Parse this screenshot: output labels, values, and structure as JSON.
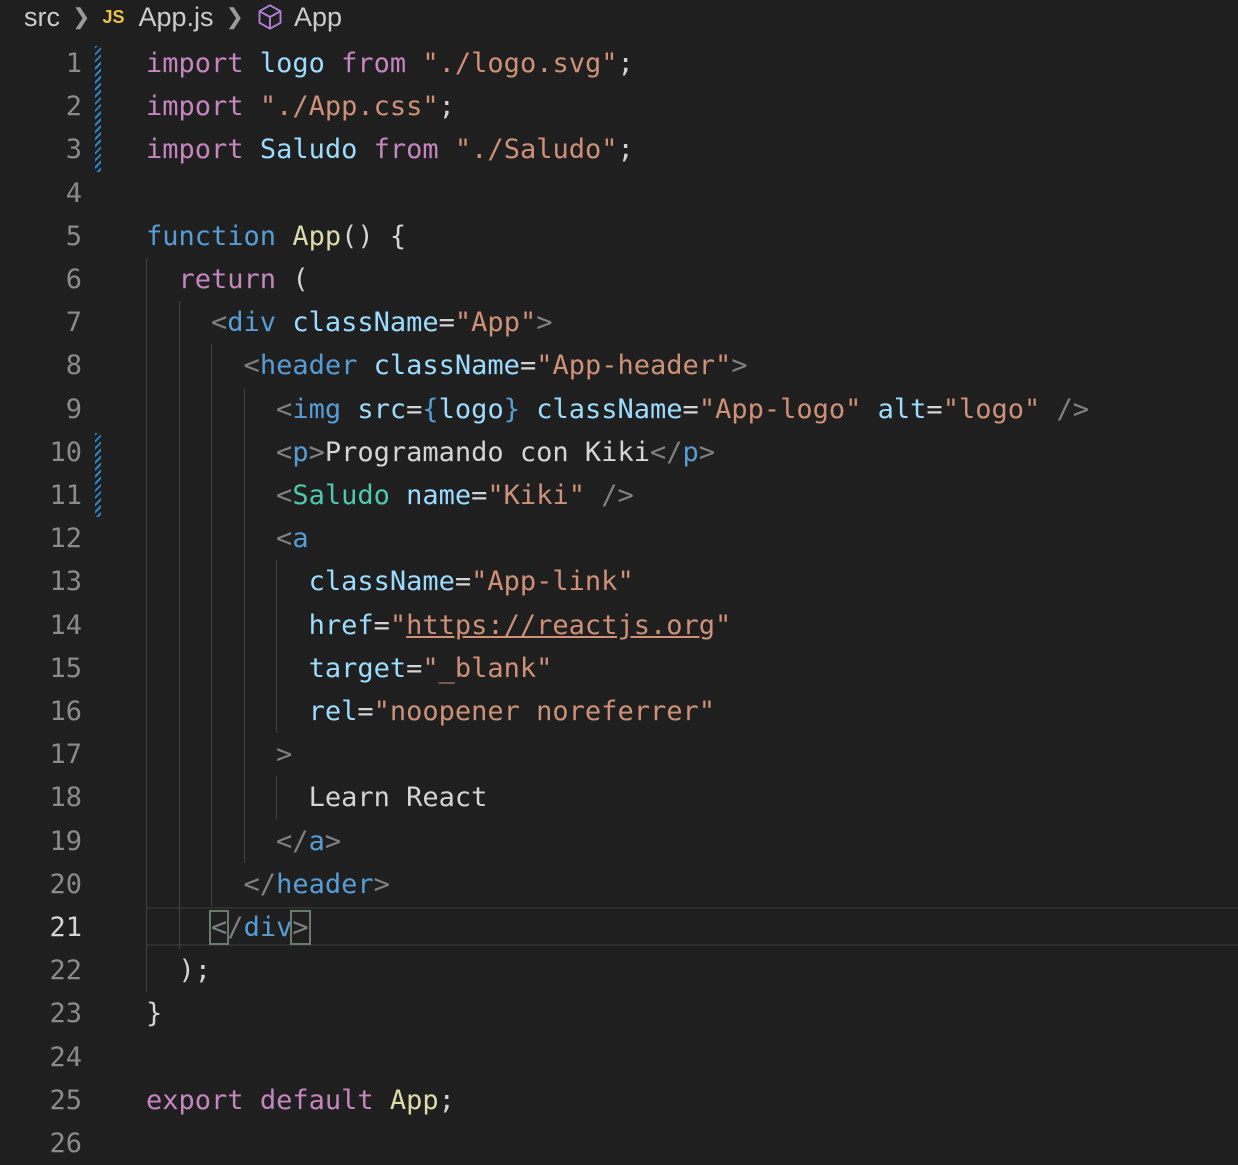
{
  "breadcrumb": {
    "folder": "src",
    "file_icon": "JS",
    "file": "App.js",
    "symbol": "App"
  },
  "editor": {
    "active_line": 21,
    "lines": [
      {
        "n": "1",
        "tokens": [
          [
            "import",
            "kw"
          ],
          [
            " ",
            ""
          ],
          [
            "logo",
            "var"
          ],
          [
            " ",
            ""
          ],
          [
            "from",
            "kw"
          ],
          [
            " ",
            ""
          ],
          [
            "\"./logo.svg\"",
            "str"
          ],
          [
            ";",
            ""
          ]
        ]
      },
      {
        "n": "2",
        "tokens": [
          [
            "import",
            "kw"
          ],
          [
            " ",
            ""
          ],
          [
            "\"./App.css\"",
            "str"
          ],
          [
            ";",
            ""
          ]
        ]
      },
      {
        "n": "3",
        "tokens": [
          [
            "import",
            "kw"
          ],
          [
            " ",
            ""
          ],
          [
            "Saludo",
            "var"
          ],
          [
            " ",
            ""
          ],
          [
            "from",
            "kw"
          ],
          [
            " ",
            ""
          ],
          [
            "\"./Saludo\"",
            "str"
          ],
          [
            ";",
            ""
          ]
        ]
      },
      {
        "n": "4",
        "tokens": []
      },
      {
        "n": "5",
        "tokens": [
          [
            "function",
            "kwb"
          ],
          [
            " ",
            ""
          ],
          [
            "App",
            "fn"
          ],
          [
            "() {",
            ""
          ]
        ]
      },
      {
        "n": "6",
        "tokens": [
          [
            "  ",
            ""
          ],
          [
            "return",
            "kw"
          ],
          [
            " (",
            ""
          ]
        ]
      },
      {
        "n": "7",
        "tokens": [
          [
            "    ",
            ""
          ],
          [
            "<",
            "punct"
          ],
          [
            "div",
            "tag"
          ],
          [
            " ",
            ""
          ],
          [
            "className",
            "var"
          ],
          [
            "=",
            ""
          ],
          [
            "\"App\"",
            "str"
          ],
          [
            ">",
            "punct"
          ]
        ]
      },
      {
        "n": "8",
        "tokens": [
          [
            "      ",
            ""
          ],
          [
            "<",
            "punct"
          ],
          [
            "header",
            "tag"
          ],
          [
            " ",
            ""
          ],
          [
            "className",
            "var"
          ],
          [
            "=",
            ""
          ],
          [
            "\"App-header\"",
            "str"
          ],
          [
            ">",
            "punct"
          ]
        ]
      },
      {
        "n": "9",
        "tokens": [
          [
            "        ",
            ""
          ],
          [
            "<",
            "punct"
          ],
          [
            "img",
            "tag"
          ],
          [
            " ",
            ""
          ],
          [
            "src",
            "var"
          ],
          [
            "=",
            ""
          ],
          [
            "{",
            "kwb"
          ],
          [
            "logo",
            "var"
          ],
          [
            "}",
            "kwb"
          ],
          [
            " ",
            ""
          ],
          [
            "className",
            "var"
          ],
          [
            "=",
            ""
          ],
          [
            "\"App-logo\"",
            "str"
          ],
          [
            " ",
            ""
          ],
          [
            "alt",
            "var"
          ],
          [
            "=",
            ""
          ],
          [
            "\"logo\"",
            "str"
          ],
          [
            " ",
            ""
          ],
          [
            "/>",
            "punct"
          ]
        ]
      },
      {
        "n": "10",
        "tokens": [
          [
            "        ",
            ""
          ],
          [
            "<",
            "punct"
          ],
          [
            "p",
            "tag"
          ],
          [
            ">",
            "punct"
          ],
          [
            "Programando con Kiki",
            ""
          ],
          [
            "</",
            "punct"
          ],
          [
            "p",
            "tag"
          ],
          [
            ">",
            "punct"
          ]
        ]
      },
      {
        "n": "11",
        "tokens": [
          [
            "        ",
            ""
          ],
          [
            "<",
            "punct"
          ],
          [
            "Saludo",
            "comp"
          ],
          [
            " ",
            ""
          ],
          [
            "name",
            "var"
          ],
          [
            "=",
            ""
          ],
          [
            "\"Kiki\"",
            "str"
          ],
          [
            " ",
            ""
          ],
          [
            "/>",
            "punct"
          ]
        ]
      },
      {
        "n": "12",
        "tokens": [
          [
            "        ",
            ""
          ],
          [
            "<",
            "punct"
          ],
          [
            "a",
            "tag"
          ]
        ]
      },
      {
        "n": "13",
        "tokens": [
          [
            "          ",
            ""
          ],
          [
            "className",
            "var"
          ],
          [
            "=",
            ""
          ],
          [
            "\"App-link\"",
            "str"
          ]
        ]
      },
      {
        "n": "14",
        "tokens": [
          [
            "          ",
            ""
          ],
          [
            "href",
            "var"
          ],
          [
            "=",
            ""
          ],
          [
            "\"",
            "str"
          ],
          [
            "https://reactjs.org",
            "url"
          ],
          [
            "\"",
            "str"
          ]
        ]
      },
      {
        "n": "15",
        "tokens": [
          [
            "          ",
            ""
          ],
          [
            "target",
            "var"
          ],
          [
            "=",
            ""
          ],
          [
            "\"_blank\"",
            "str"
          ]
        ]
      },
      {
        "n": "16",
        "tokens": [
          [
            "          ",
            ""
          ],
          [
            "rel",
            "var"
          ],
          [
            "=",
            ""
          ],
          [
            "\"noopener noreferrer\"",
            "str"
          ]
        ]
      },
      {
        "n": "17",
        "tokens": [
          [
            "        ",
            ""
          ],
          [
            ">",
            "punct"
          ]
        ]
      },
      {
        "n": "18",
        "tokens": [
          [
            "          ",
            ""
          ],
          [
            "Learn React",
            ""
          ]
        ]
      },
      {
        "n": "19",
        "tokens": [
          [
            "        ",
            ""
          ],
          [
            "</",
            "punct"
          ],
          [
            "a",
            "tag"
          ],
          [
            ">",
            "punct"
          ]
        ]
      },
      {
        "n": "20",
        "tokens": [
          [
            "      ",
            ""
          ],
          [
            "</",
            "punct"
          ],
          [
            "header",
            "tag"
          ],
          [
            ">",
            "punct"
          ]
        ]
      },
      {
        "n": "21",
        "tokens": [
          [
            "    ",
            ""
          ],
          [
            "<",
            "punct bracket-match"
          ],
          [
            "/",
            "punct"
          ],
          [
            "div",
            "tag"
          ],
          [
            ">",
            "punct bracket-match"
          ]
        ]
      },
      {
        "n": "22",
        "tokens": [
          [
            "  );",
            ""
          ]
        ]
      },
      {
        "n": "23",
        "tokens": [
          [
            "}",
            ""
          ]
        ]
      },
      {
        "n": "24",
        "tokens": []
      },
      {
        "n": "25",
        "tokens": [
          [
            "export",
            "kw"
          ],
          [
            " ",
            ""
          ],
          [
            "default",
            "kw"
          ],
          [
            " ",
            ""
          ],
          [
            "App",
            "fn"
          ],
          [
            ";",
            ""
          ]
        ]
      },
      {
        "n": "26",
        "tokens": []
      }
    ]
  }
}
